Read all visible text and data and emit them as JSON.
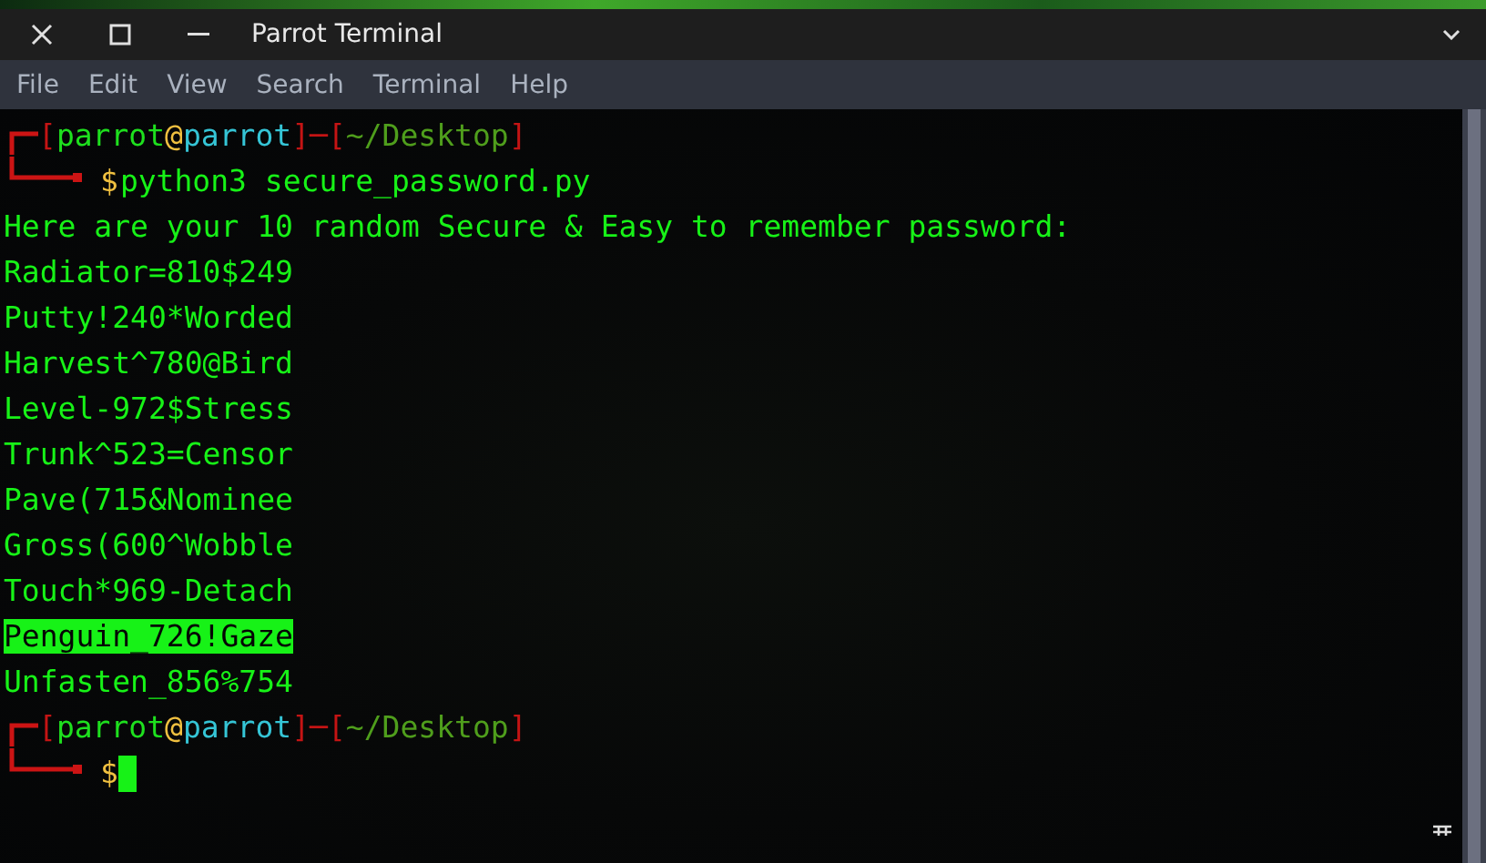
{
  "window": {
    "title": "Parrot Terminal"
  },
  "menu": [
    "File",
    "Edit",
    "View",
    "Search",
    "Terminal",
    "Help"
  ],
  "lines": [
    {
      "kind": "prompt_top",
      "segments": [
        {
          "text": "[",
          "kind": "bracket"
        },
        {
          "text": "parrot",
          "kind": "user"
        },
        {
          "text": "@",
          "kind": "at"
        },
        {
          "text": "parrot",
          "kind": "host"
        },
        {
          "text": "]─[",
          "kind": "bracket"
        },
        {
          "text": "~/Desktop",
          "kind": "path"
        },
        {
          "text": "]",
          "kind": "bracket"
        }
      ]
    },
    {
      "kind": "prompt_bottom",
      "symbol": "$",
      "command": "python3 secure_password.py",
      "cursor": false
    },
    {
      "kind": "output",
      "text": "Here are your 10 random Secure & Easy to remember password:",
      "selected": false
    },
    {
      "kind": "output",
      "text": "Radiator=810$249",
      "selected": false
    },
    {
      "kind": "output",
      "text": "Putty!240*Worded",
      "selected": false
    },
    {
      "kind": "output",
      "text": "Harvest^780@Bird",
      "selected": false
    },
    {
      "kind": "output",
      "text": "Level-972$Stress",
      "selected": false
    },
    {
      "kind": "output",
      "text": "Trunk^523=Censor",
      "selected": false
    },
    {
      "kind": "output",
      "text": "Pave(715&Nominee",
      "selected": false
    },
    {
      "kind": "output",
      "text": "Gross(600^Wobble",
      "selected": false
    },
    {
      "kind": "output",
      "text": "Touch*969-Detach",
      "selected": false
    },
    {
      "kind": "output",
      "text": "Penguin_726!Gaze",
      "selected": true
    },
    {
      "kind": "output",
      "text": "Unfasten_856%754",
      "selected": false
    },
    {
      "kind": "prompt_top",
      "segments": [
        {
          "text": "[",
          "kind": "bracket"
        },
        {
          "text": "parrot",
          "kind": "user"
        },
        {
          "text": "@",
          "kind": "at"
        },
        {
          "text": "parrot",
          "kind": "host"
        },
        {
          "text": "]─[",
          "kind": "bracket"
        },
        {
          "text": "~/Desktop",
          "kind": "path"
        },
        {
          "text": "]",
          "kind": "bracket"
        }
      ]
    },
    {
      "kind": "prompt_bottom",
      "symbol": "$",
      "cursor": true
    }
  ]
}
